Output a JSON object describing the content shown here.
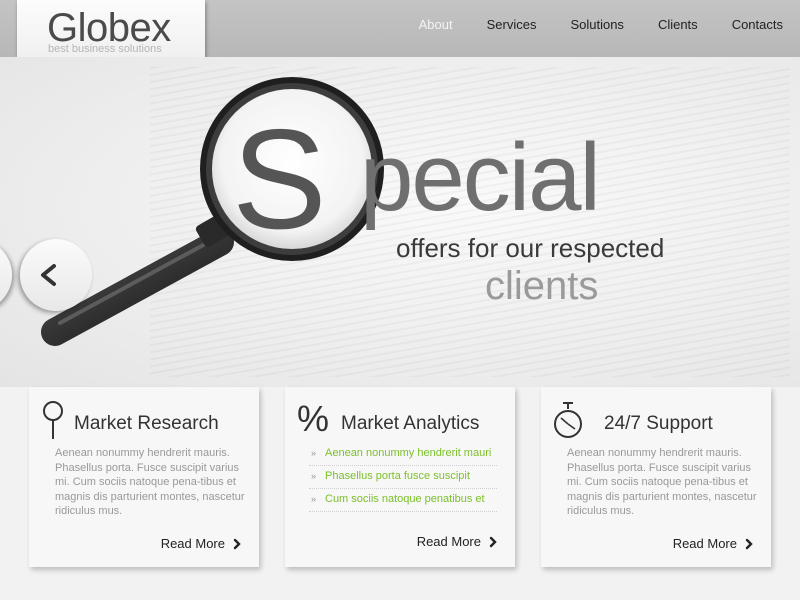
{
  "header": {
    "logo_title": "Globex",
    "logo_tagline": "best business solutions",
    "nav": [
      "About",
      "Services",
      "Solutions",
      "Clients",
      "Contacts"
    ],
    "active_nav": "About"
  },
  "hero": {
    "headline_big_letter": "S",
    "headline_rest": "pecial",
    "subline": "offers for our respected",
    "subline2": "clients"
  },
  "cards": [
    {
      "title": "Market Research",
      "icon": "magnifier-icon",
      "text": "Aenean nonummy hendrerit mauris. Phasellus porta. Fusce suscipit varius mi. Cum sociis natoque pena-tibus et magnis dis parturient montes, nascetur ridiculus mus.",
      "read_more": "Read More"
    },
    {
      "title": "Market Analytics",
      "icon": "percent-icon",
      "list": [
        "Aenean nonummy hendrerit mauri",
        "Phasellus porta fusce suscipit",
        "Cum sociis natoque penatibus et"
      ],
      "read_more": "Read More"
    },
    {
      "title": "24/7 Support",
      "icon": "stopwatch-icon",
      "text": "Aenean nonummy hendrerit mauris. Phasellus porta. Fusce suscipit varius mi. Cum sociis natoque pena-tibus et magnis dis parturient montes, nascetur ridiculus mus.",
      "read_more": "Read More"
    }
  ],
  "colors": {
    "accent_green": "#7cc02a",
    "header_bar": "#bdbdbd"
  }
}
